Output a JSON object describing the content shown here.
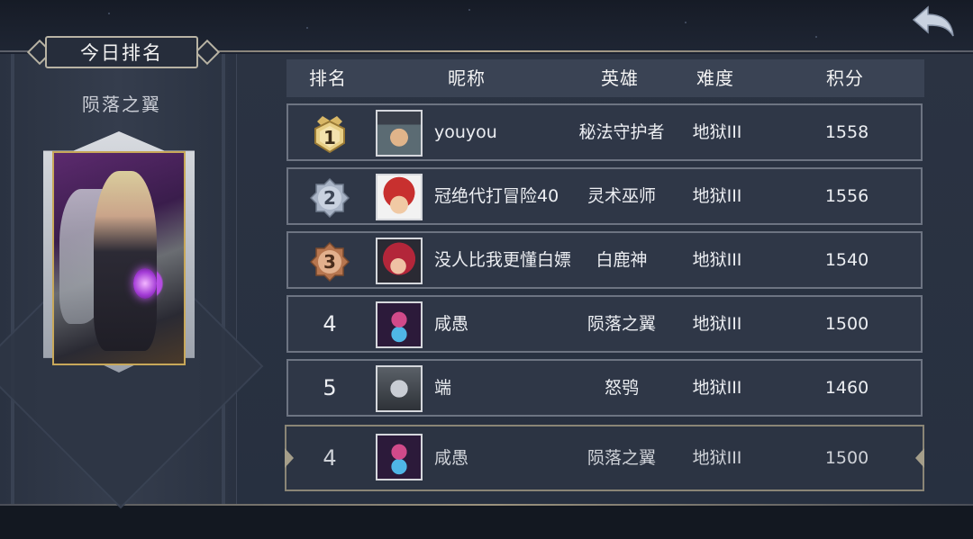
{
  "title_tab": "今日排名",
  "selected_hero": {
    "name": "陨落之翼"
  },
  "table": {
    "headers": {
      "rank": "排名",
      "nickname": "昵称",
      "hero": "英雄",
      "difficulty": "难度",
      "score": "积分"
    },
    "rows": [
      {
        "rank": "1",
        "nickname": "youyou",
        "hero": "秘法守护者",
        "difficulty": "地狱III",
        "score": "1558",
        "medal": "gold",
        "avatar": "hat-mage-avatar"
      },
      {
        "rank": "2",
        "nickname": "冠绝代打冒险40",
        "hero": "灵术巫师",
        "difficulty": "地狱III",
        "score": "1556",
        "medal": "silver",
        "avatar": "red-hood-girl-avatar"
      },
      {
        "rank": "3",
        "nickname": "没人比我更懂白嫖",
        "hero": "白鹿神",
        "difficulty": "地狱III",
        "score": "1540",
        "medal": "bronze",
        "avatar": "red-hair-avatar"
      },
      {
        "rank": "4",
        "nickname": "咸愚",
        "hero": "陨落之翼",
        "difficulty": "地狱III",
        "score": "1500",
        "medal": "none",
        "avatar": "fallen-wing-avatar"
      },
      {
        "rank": "5",
        "nickname": "端",
        "hero": "怒鸮",
        "difficulty": "地狱III",
        "score": "1460",
        "medal": "none",
        "avatar": "owl-avatar"
      }
    ],
    "my_row": {
      "rank": "4",
      "nickname": "咸愚",
      "hero": "陨落之翼",
      "difficulty": "地狱III",
      "score": "1500",
      "avatar": "fallen-wing-avatar"
    }
  },
  "colors": {
    "gold_medal": "#d8b766",
    "silver_medal": "#a9b4c6",
    "bronze_medal": "#b7764f",
    "accent_border": "#b8b3a4"
  },
  "icons": {
    "back": "back-arrow-icon"
  }
}
